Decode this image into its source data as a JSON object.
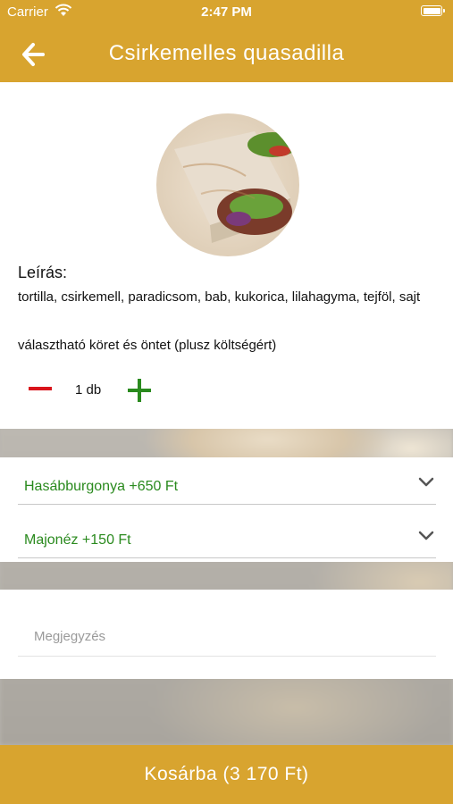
{
  "status_bar": {
    "carrier": "Carrier",
    "time": "2:47 PM"
  },
  "header": {
    "title": "Csirkemelles quasadilla",
    "back_icon": "arrow-left-icon"
  },
  "product": {
    "description_title": "Leírás:",
    "description": "tortilla, csirkemell, paradicsom, bab, kukorica, lilahagyma, tejföl, sajt",
    "extra_note": "választható köret és öntet (plusz költségért)",
    "quantity": "1 db"
  },
  "options": [
    {
      "label": "Hasábburgonya +650 Ft"
    },
    {
      "label": "Majonéz +150 Ft"
    }
  ],
  "note": {
    "placeholder": "Megjegyzés",
    "value": ""
  },
  "cart_button": {
    "label": "Kosárba (3 170 Ft)"
  },
  "colors": {
    "accent": "#d8a42f",
    "minus": "#d9141b",
    "plus": "#2a8a1e",
    "option_text": "#2a8a1e"
  }
}
